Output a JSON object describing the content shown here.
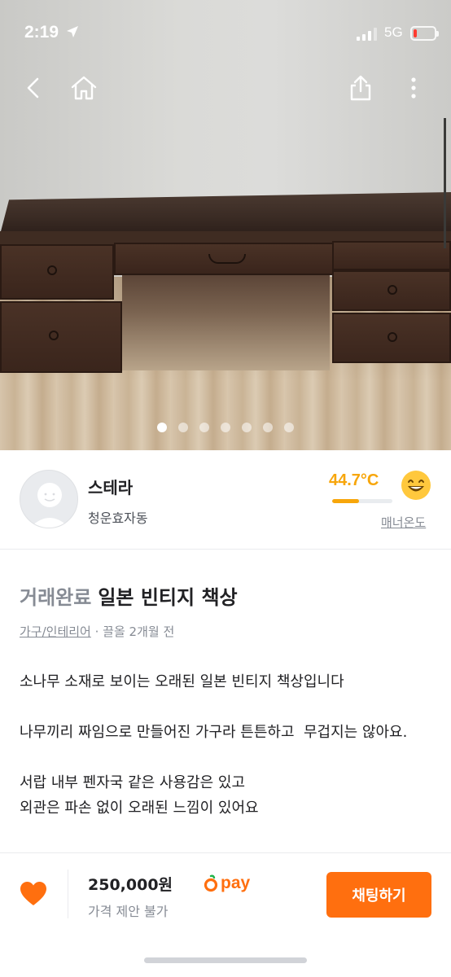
{
  "status_bar": {
    "time": "2:19",
    "network": "5G",
    "battery_level": 0.15,
    "icons": [
      "location-arrow-icon",
      "signal-icon",
      "battery-icon"
    ]
  },
  "nav": {
    "icons": [
      "back-icon",
      "home-icon",
      "share-icon",
      "more-icon"
    ]
  },
  "gallery": {
    "photo_count": 7,
    "active_index": 0
  },
  "seller": {
    "nickname": "스테라",
    "region": "청운효자동",
    "manner_temp": "44.7°C",
    "manner_temp_level": 0.447,
    "manner_label": "매너온도",
    "temp_color": "#f7a60b"
  },
  "post": {
    "status": "거래완료",
    "title": "일본 빈티지 책상",
    "category": "가구/인테리어",
    "meta_rest": " · 끌올 2개월 전",
    "description": "소나무 소재로 보이는 오래된 일본 빈티지 책상입니다\n\n나무끼리 짜임으로 만들어진 가구라 튼튼하고  무겁지는 않아요.\n\n서랍 내부 펜자국 같은 사용감은 있고\n외관은 파손 없이 오래된 느낌이 있어요"
  },
  "bottom_bar": {
    "price": "250,000원",
    "negotiation": "가격 제안 불가",
    "pay_label": "pay",
    "chat_button": "채팅하기",
    "accent": "#ff6f0f"
  }
}
